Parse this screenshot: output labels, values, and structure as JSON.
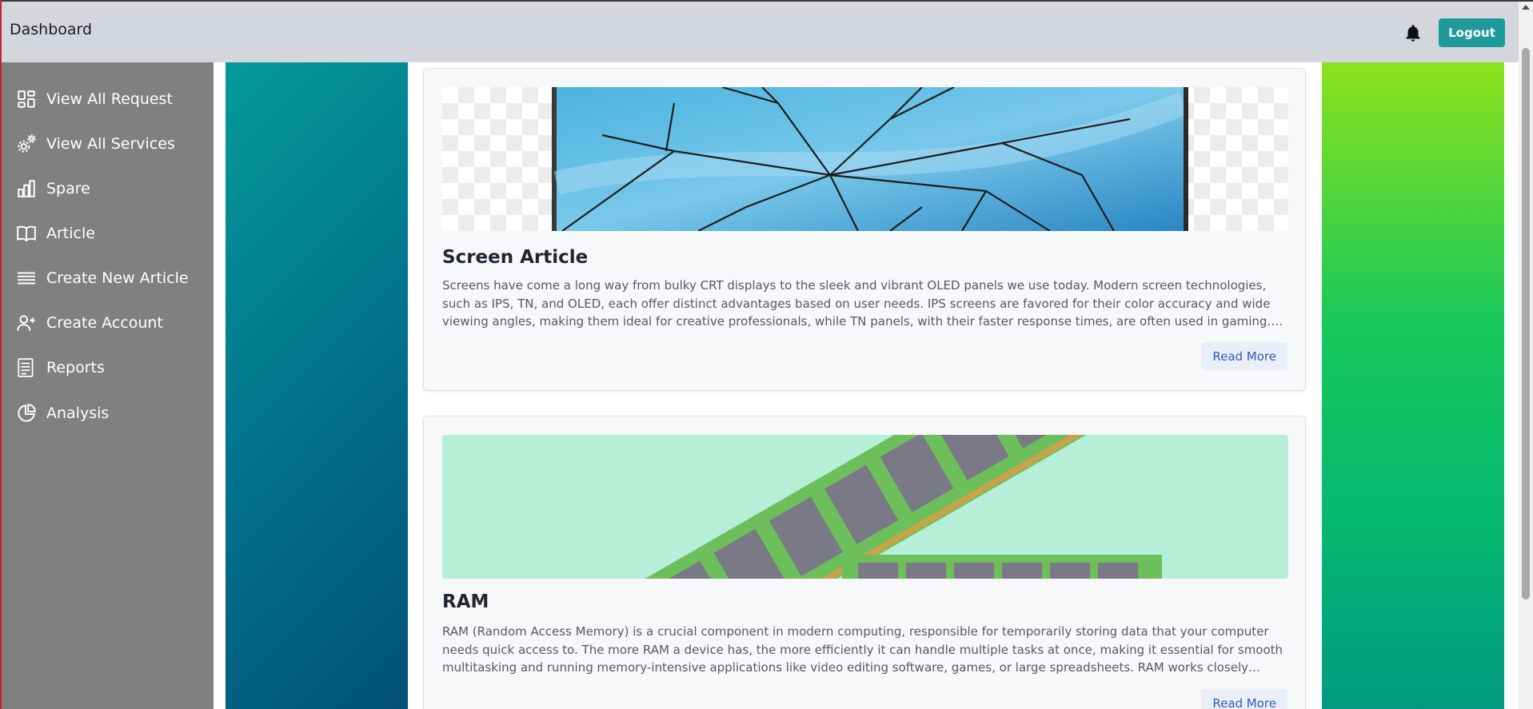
{
  "header": {
    "title": "Dashboard",
    "logout_label": "Logout"
  },
  "sidebar": {
    "items": [
      {
        "label": "View All Request",
        "icon": "dashboard-grid-icon"
      },
      {
        "label": "View All Services",
        "icon": "gears-icon"
      },
      {
        "label": "Spare",
        "icon": "bar-chart-icon"
      },
      {
        "label": "Article",
        "icon": "open-book-icon"
      },
      {
        "label": "Create New Article",
        "icon": "lines-list-icon"
      },
      {
        "label": "Create Account",
        "icon": "user-plus-icon"
      },
      {
        "label": "Reports",
        "icon": "report-document-icon"
      },
      {
        "label": "Analysis",
        "icon": "pie-chart-icon"
      }
    ]
  },
  "articles": [
    {
      "title": "Screen Article",
      "text": "Screens have come a long way from bulky CRT displays to the sleek and vibrant OLED panels we use today. Modern screen technologies, such as IPS, TN, and OLED, each offer distinct advantages based on user needs. IPS screens are favored for their color accuracy and wide viewing angles, making them ideal for creative professionals, while TN panels, with their faster response times, are often used in gaming. OLED...",
      "read_more": "Read More",
      "image": "cracked-screen-image"
    },
    {
      "title": "RAM",
      "text": "RAM (Random Access Memory) is a crucial component in modern computing, responsible for temporarily storing data that your computer needs quick access to. The more RAM a device has, the more efficiently it can handle multiple tasks at once, making it essential for smooth multitasking and running memory-intensive applications like video editing software, games, or large spreadsheets. RAM works closely with...",
      "read_more": "Read More",
      "image": "ram-modules-image"
    }
  ],
  "colors": {
    "topbar": "#d3d6dd",
    "sidebar": "#808080",
    "logout_button": "#1f9a9a",
    "read_more_text": "#2c5fbf"
  }
}
